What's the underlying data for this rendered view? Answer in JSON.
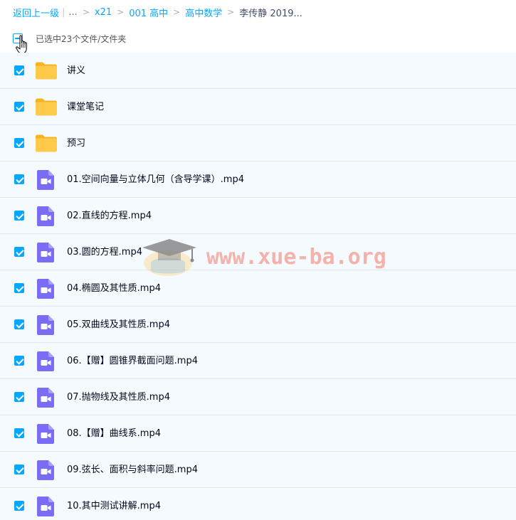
{
  "breadcrumb": {
    "back": "返回上一级",
    "ellipsis": "...",
    "items": [
      "x21",
      "001 高中",
      "高中数学"
    ],
    "current": "李传静 2019..."
  },
  "selection": {
    "text": "已选中23个文件/文件夹",
    "state": "partial"
  },
  "files": [
    {
      "type": "folder",
      "name": "讲义",
      "checked": true
    },
    {
      "type": "folder",
      "name": "课堂笔记",
      "checked": true
    },
    {
      "type": "folder",
      "name": "预习",
      "checked": true
    },
    {
      "type": "video",
      "name": "01.空间向量与立体几何（含导学课）.mp4",
      "checked": true
    },
    {
      "type": "video",
      "name": "02.直线的方程.mp4",
      "checked": true
    },
    {
      "type": "video",
      "name": "03.圆的方程.mp4",
      "checked": true
    },
    {
      "type": "video",
      "name": "04.椭圆及其性质.mp4",
      "checked": true
    },
    {
      "type": "video",
      "name": "05.双曲线及其性质.mp4",
      "checked": true
    },
    {
      "type": "video",
      "name": "06.【赠】圆锥界截面问题.mp4",
      "checked": true
    },
    {
      "type": "video",
      "name": "07.抛物线及其性质.mp4",
      "checked": true
    },
    {
      "type": "video",
      "name": "08.【赠】曲线系.mp4",
      "checked": true
    },
    {
      "type": "video",
      "name": "09.弦长、面积与斜率问题.mp4",
      "checked": true
    },
    {
      "type": "video",
      "name": "10.其中测试讲解.mp4",
      "checked": true
    }
  ],
  "watermark": {
    "text": "www.xue-ba.org"
  },
  "colors": {
    "accent": "#06a7ff",
    "folder": "#ffc94d",
    "video": "#7b6cf6",
    "row_bg": "#f5faff"
  }
}
